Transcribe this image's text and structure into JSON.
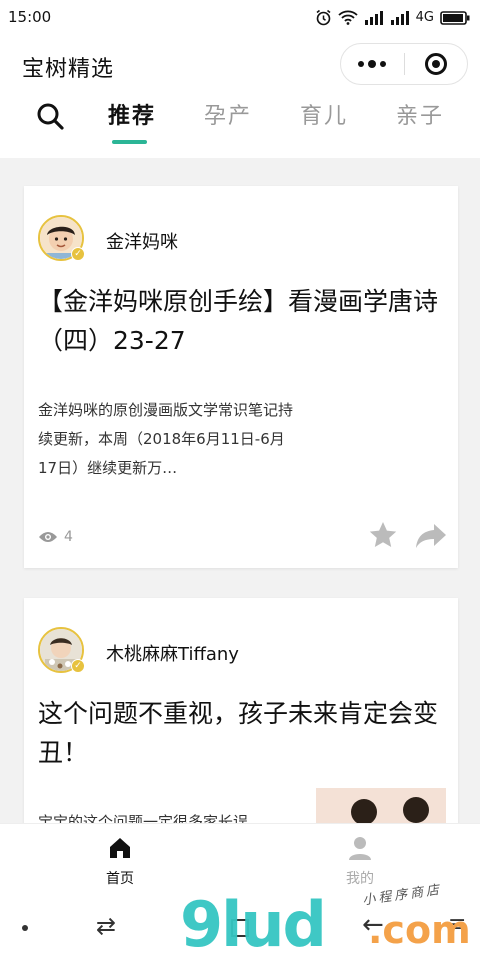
{
  "status_bar": {
    "time": "15:00",
    "network": "4G"
  },
  "nav": {
    "title": "宝树精选"
  },
  "tabs": [
    {
      "label": "推荐",
      "active": true
    },
    {
      "label": "孕产",
      "active": false
    },
    {
      "label": "育儿",
      "active": false
    },
    {
      "label": "亲子",
      "active": false
    }
  ],
  "colors": {
    "accent": "#2bb596",
    "avatar_ring": "#e7c23f",
    "inactive_text": "#999999"
  },
  "posts": [
    {
      "author": "金洋妈咪",
      "title": "【金洋妈咪原创手绘】看漫画学唐诗（四）23-27",
      "description": "金洋妈咪的原创漫画版文学常识笔记持续更新，本周（2018年6月11日-6月17日）继续更新万…",
      "views": "4"
    },
    {
      "author": "木桃麻麻Tiffany",
      "title": "这个问题不重视，孩子未来肯定会变丑！",
      "description": "宝宝的这个问题一定很多家长误"
    }
  ],
  "bottom_tabs": [
    {
      "label": "首页",
      "icon": "home-icon",
      "active": true
    },
    {
      "label": "我的",
      "icon": "user-icon",
      "active": false
    }
  ],
  "watermark": {
    "logo": "9lud",
    "domain": ".com",
    "sub": "小程序商店"
  }
}
